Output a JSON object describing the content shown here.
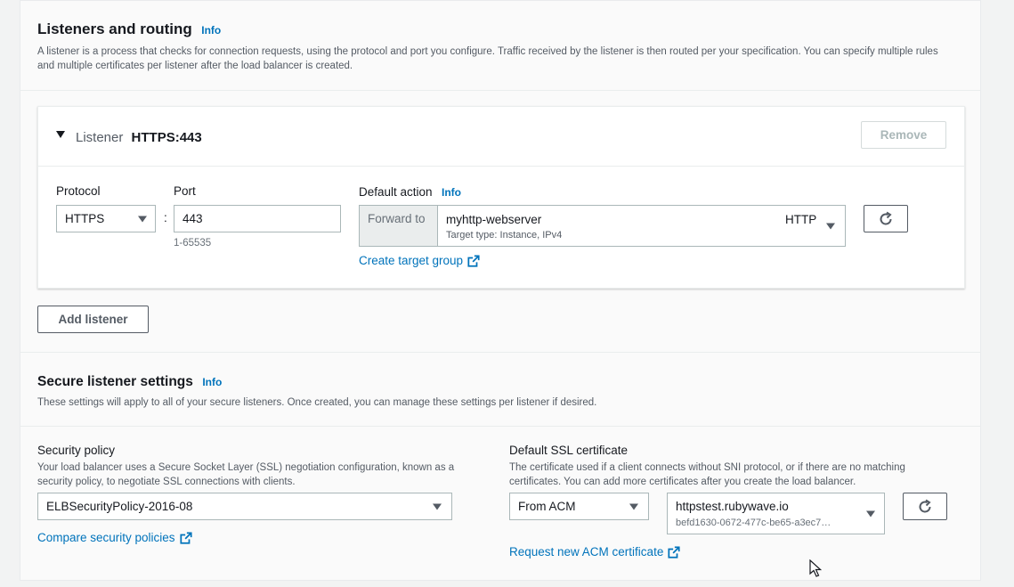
{
  "listeners_section": {
    "title": "Listeners and routing",
    "info": "Info",
    "description": "A listener is a process that checks for connection requests, using the protocol and port you configure. Traffic received by the listener is then routed per your specification. You can specify multiple rules and multiple certificates per listener after the load balancer is created."
  },
  "listener": {
    "label": "Listener",
    "name": "HTTPS:443",
    "remove_label": "Remove",
    "protocol_label": "Protocol",
    "protocol_value": "HTTPS",
    "port_label": "Port",
    "port_value": "443",
    "port_hint": "1-65535",
    "separator": ":",
    "default_action_label": "Default action",
    "default_action_info": "Info",
    "forward_to_label": "Forward to",
    "target_group_name": "myhttp-webserver",
    "target_group_type": "Target type: Instance, IPv4",
    "target_group_protocol": "HTTP",
    "create_target_group_label": "Create target group"
  },
  "add_listener_label": "Add listener",
  "secure_section": {
    "title": "Secure listener settings",
    "info": "Info",
    "description": "These settings will apply to all of your secure listeners. Once created, you can manage these settings per listener if desired."
  },
  "security_policy": {
    "label": "Security policy",
    "description": "Your load balancer uses a Secure Socket Layer (SSL) negotiation configuration, known as a security policy, to negotiate SSL connections with clients.",
    "value": "ELBSecurityPolicy-2016-08",
    "compare_link": "Compare security policies"
  },
  "ssl_certificate": {
    "label": "Default SSL certificate",
    "description": "The certificate used if a client connects without SNI protocol, or if there are no matching certificates. You can add more certificates after you create the load balancer.",
    "source_value": "From ACM",
    "cert_name": "httpstest.rubywave.io",
    "cert_id": "befd1630-0672-477c-be65-a3ec7…",
    "request_link": "Request new ACM certificate"
  },
  "colors": {
    "link": "#0073bb",
    "text": "#16191f",
    "muted": "#545b64"
  },
  "icons": [
    "caret-down-icon",
    "refresh-icon",
    "external-link-icon",
    "expand-triangle-icon",
    "mouse-cursor-icon"
  ]
}
